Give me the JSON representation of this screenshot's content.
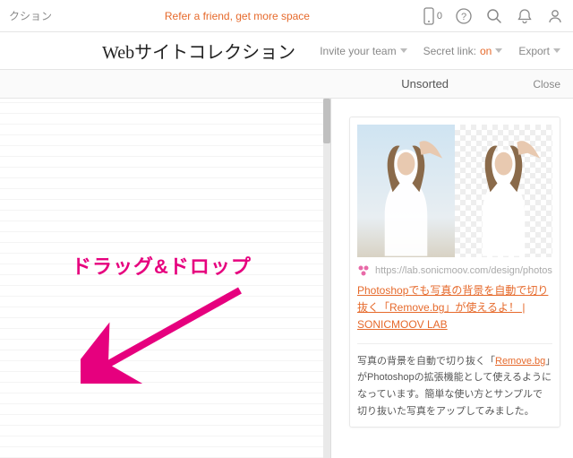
{
  "topbar": {
    "left_fragment": "クション",
    "refer_text": "Refer a friend, get more space",
    "mobile_count": "0"
  },
  "titlebar": {
    "page_title": "Webサイトコレクション",
    "invite_label": "Invite your team",
    "secret_label": "Secret link:",
    "secret_state": "on",
    "export_label": "Export"
  },
  "panel": {
    "title": "Unsorted",
    "close": "Close"
  },
  "annotation": {
    "drag_text": "ドラッグ&ドロップ"
  },
  "card": {
    "source_url": "https://lab.sonicmoov.com/design/photos",
    "title_pre": "Photoshopでも写真の背景を自動で切り抜く「",
    "title_link": "Remove.bg",
    "title_post": "」が使えるよ！ | SONICMOOV LAB",
    "body_pre": "写真の背景を自動で切り抜く「",
    "body_link": "Remove.bg",
    "body_post": "」がPhotoshopの拡張機能として使えるようになっています。簡単な使い方とサンプルで切り抜いた写真をアップしてみました。"
  }
}
